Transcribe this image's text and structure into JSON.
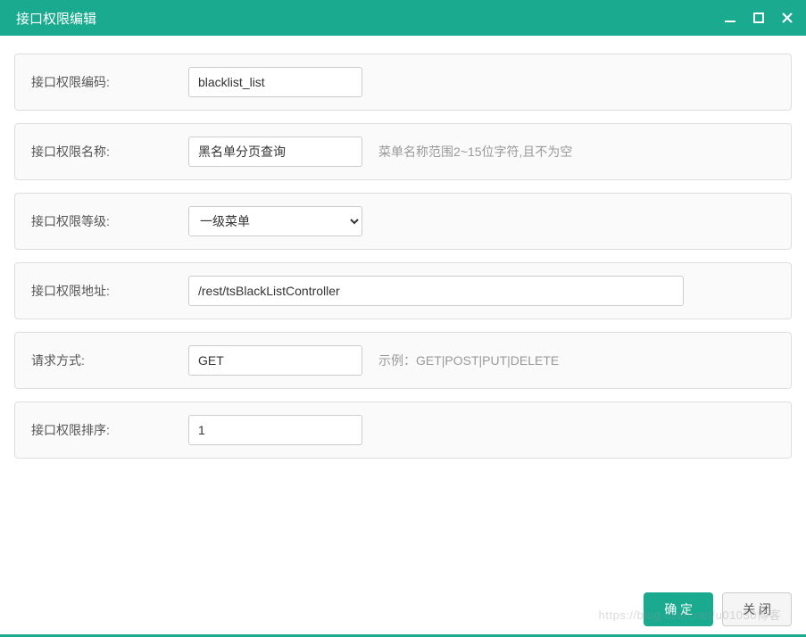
{
  "window": {
    "title": "接口权限编辑"
  },
  "form": {
    "code": {
      "label": "接口权限编码:",
      "value": "blacklist_list"
    },
    "name": {
      "label": "接口权限名称:",
      "value": "黑名单分页查询",
      "hint": "菜单名称范围2~15位字符,且不为空"
    },
    "level": {
      "label": "接口权限等级:",
      "selected": "一级菜单"
    },
    "address": {
      "label": "接口权限地址:",
      "value": "/rest/tsBlackListController"
    },
    "method": {
      "label": "请求方式:",
      "value": "GET",
      "hint": "示例：GET|POST|PUT|DELETE"
    },
    "order": {
      "label": "接口权限排序:",
      "value": "1"
    }
  },
  "buttons": {
    "confirm": "确 定",
    "close": "关 闭"
  },
  "watermark": "https://blog.csdn.net/u01030博客"
}
